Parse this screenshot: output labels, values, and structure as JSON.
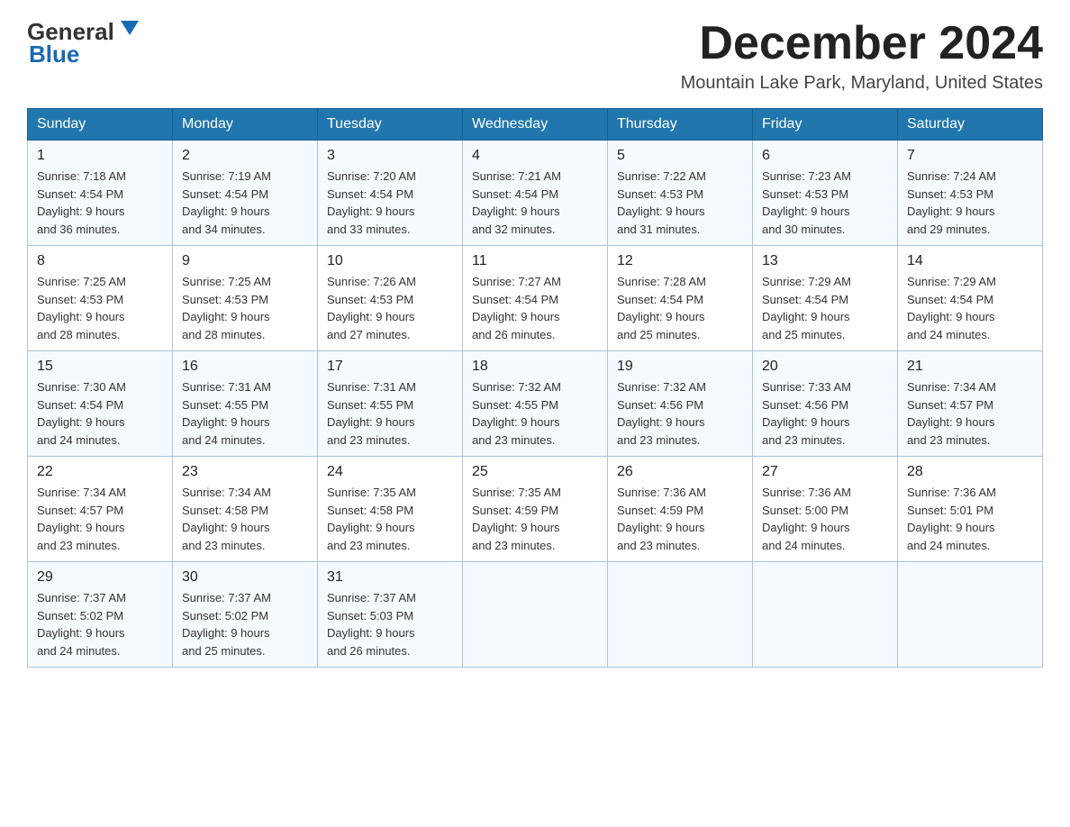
{
  "header": {
    "logo_general": "General",
    "logo_blue": "Blue",
    "month_title": "December 2024",
    "location": "Mountain Lake Park, Maryland, United States"
  },
  "weekdays": [
    "Sunday",
    "Monday",
    "Tuesday",
    "Wednesday",
    "Thursday",
    "Friday",
    "Saturday"
  ],
  "weeks": [
    [
      {
        "day": "1",
        "sunrise": "7:18 AM",
        "sunset": "4:54 PM",
        "daylight": "9 hours and 36 minutes."
      },
      {
        "day": "2",
        "sunrise": "7:19 AM",
        "sunset": "4:54 PM",
        "daylight": "9 hours and 34 minutes."
      },
      {
        "day": "3",
        "sunrise": "7:20 AM",
        "sunset": "4:54 PM",
        "daylight": "9 hours and 33 minutes."
      },
      {
        "day": "4",
        "sunrise": "7:21 AM",
        "sunset": "4:54 PM",
        "daylight": "9 hours and 32 minutes."
      },
      {
        "day": "5",
        "sunrise": "7:22 AM",
        "sunset": "4:53 PM",
        "daylight": "9 hours and 31 minutes."
      },
      {
        "day": "6",
        "sunrise": "7:23 AM",
        "sunset": "4:53 PM",
        "daylight": "9 hours and 30 minutes."
      },
      {
        "day": "7",
        "sunrise": "7:24 AM",
        "sunset": "4:53 PM",
        "daylight": "9 hours and 29 minutes."
      }
    ],
    [
      {
        "day": "8",
        "sunrise": "7:25 AM",
        "sunset": "4:53 PM",
        "daylight": "9 hours and 28 minutes."
      },
      {
        "day": "9",
        "sunrise": "7:25 AM",
        "sunset": "4:53 PM",
        "daylight": "9 hours and 28 minutes."
      },
      {
        "day": "10",
        "sunrise": "7:26 AM",
        "sunset": "4:53 PM",
        "daylight": "9 hours and 27 minutes."
      },
      {
        "day": "11",
        "sunrise": "7:27 AM",
        "sunset": "4:54 PM",
        "daylight": "9 hours and 26 minutes."
      },
      {
        "day": "12",
        "sunrise": "7:28 AM",
        "sunset": "4:54 PM",
        "daylight": "9 hours and 25 minutes."
      },
      {
        "day": "13",
        "sunrise": "7:29 AM",
        "sunset": "4:54 PM",
        "daylight": "9 hours and 25 minutes."
      },
      {
        "day": "14",
        "sunrise": "7:29 AM",
        "sunset": "4:54 PM",
        "daylight": "9 hours and 24 minutes."
      }
    ],
    [
      {
        "day": "15",
        "sunrise": "7:30 AM",
        "sunset": "4:54 PM",
        "daylight": "9 hours and 24 minutes."
      },
      {
        "day": "16",
        "sunrise": "7:31 AM",
        "sunset": "4:55 PM",
        "daylight": "9 hours and 24 minutes."
      },
      {
        "day": "17",
        "sunrise": "7:31 AM",
        "sunset": "4:55 PM",
        "daylight": "9 hours and 23 minutes."
      },
      {
        "day": "18",
        "sunrise": "7:32 AM",
        "sunset": "4:55 PM",
        "daylight": "9 hours and 23 minutes."
      },
      {
        "day": "19",
        "sunrise": "7:32 AM",
        "sunset": "4:56 PM",
        "daylight": "9 hours and 23 minutes."
      },
      {
        "day": "20",
        "sunrise": "7:33 AM",
        "sunset": "4:56 PM",
        "daylight": "9 hours and 23 minutes."
      },
      {
        "day": "21",
        "sunrise": "7:34 AM",
        "sunset": "4:57 PM",
        "daylight": "9 hours and 23 minutes."
      }
    ],
    [
      {
        "day": "22",
        "sunrise": "7:34 AM",
        "sunset": "4:57 PM",
        "daylight": "9 hours and 23 minutes."
      },
      {
        "day": "23",
        "sunrise": "7:34 AM",
        "sunset": "4:58 PM",
        "daylight": "9 hours and 23 minutes."
      },
      {
        "day": "24",
        "sunrise": "7:35 AM",
        "sunset": "4:58 PM",
        "daylight": "9 hours and 23 minutes."
      },
      {
        "day": "25",
        "sunrise": "7:35 AM",
        "sunset": "4:59 PM",
        "daylight": "9 hours and 23 minutes."
      },
      {
        "day": "26",
        "sunrise": "7:36 AM",
        "sunset": "4:59 PM",
        "daylight": "9 hours and 23 minutes."
      },
      {
        "day": "27",
        "sunrise": "7:36 AM",
        "sunset": "5:00 PM",
        "daylight": "9 hours and 24 minutes."
      },
      {
        "day": "28",
        "sunrise": "7:36 AM",
        "sunset": "5:01 PM",
        "daylight": "9 hours and 24 minutes."
      }
    ],
    [
      {
        "day": "29",
        "sunrise": "7:37 AM",
        "sunset": "5:02 PM",
        "daylight": "9 hours and 24 minutes."
      },
      {
        "day": "30",
        "sunrise": "7:37 AM",
        "sunset": "5:02 PM",
        "daylight": "9 hours and 25 minutes."
      },
      {
        "day": "31",
        "sunrise": "7:37 AM",
        "sunset": "5:03 PM",
        "daylight": "9 hours and 26 minutes."
      },
      null,
      null,
      null,
      null
    ]
  ],
  "labels": {
    "sunrise": "Sunrise:",
    "sunset": "Sunset:",
    "daylight": "Daylight:"
  }
}
